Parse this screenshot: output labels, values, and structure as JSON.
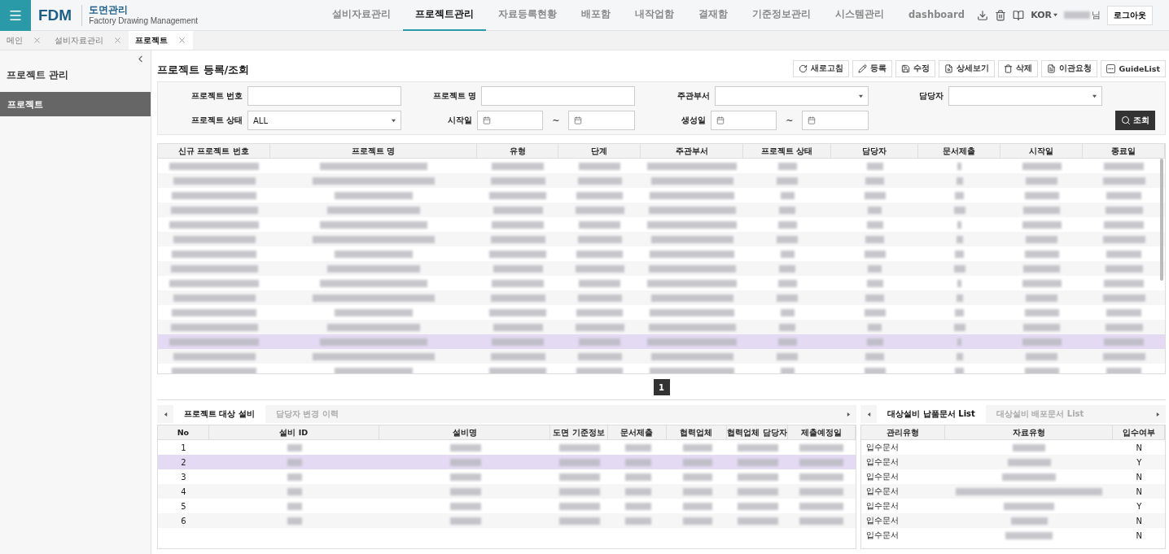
{
  "app": {
    "logo": "FDM",
    "title": "도면관리",
    "subtitle": "Factory Drawing Management"
  },
  "nav": [
    {
      "label": "설비자료관리",
      "selected": false
    },
    {
      "label": "프로젝트관리",
      "selected": true
    },
    {
      "label": "자료등록현황",
      "selected": false
    },
    {
      "label": "배포함",
      "selected": false
    },
    {
      "label": "내작업함",
      "selected": false
    },
    {
      "label": "결재함",
      "selected": false
    },
    {
      "label": "기준정보관리",
      "selected": false
    },
    {
      "label": "시스템관리",
      "selected": false
    },
    {
      "label": "dashboard",
      "selected": false
    }
  ],
  "user": {
    "language": "KOR",
    "suffix": "님",
    "logout": "로그아웃"
  },
  "open_tabs": [
    {
      "label": "메인",
      "selected": false
    },
    {
      "label": "설비자료관리",
      "selected": false
    },
    {
      "label": "프로젝트",
      "selected": true
    }
  ],
  "sidebar": {
    "title": "프로젝트 관리",
    "items": [
      {
        "label": "프로젝트",
        "selected": true
      }
    ]
  },
  "page_title": "프로젝트 등록/조회",
  "toolbar": [
    {
      "label": "새로고침"
    },
    {
      "label": "등록"
    },
    {
      "label": "수정"
    },
    {
      "label": "상세보기"
    },
    {
      "label": "삭제"
    },
    {
      "label": "이관요청"
    },
    {
      "label": "GuideList"
    }
  ],
  "filters": [
    {
      "label": "프로젝트 번호",
      "kind": "text"
    },
    {
      "label": "프로젝트 명",
      "kind": "text"
    },
    {
      "label": "주관부서",
      "kind": "select"
    },
    {
      "label": "담당자",
      "kind": "select"
    },
    {
      "label": "프로젝트 상태",
      "kind": "select",
      "value": "ALL"
    },
    {
      "label": "시작일",
      "kind": "daterange",
      "separator": "~"
    },
    {
      "label": "생성일",
      "kind": "daterange",
      "separator": "~"
    }
  ],
  "search_button": "조회",
  "table": {
    "columns": [
      "신규 프로젝트 번호",
      "프로젝트 명",
      "유형",
      "단계",
      "주관부서",
      "프로젝트 상태",
      "담당자",
      "문서제출",
      "시작일",
      "종료일"
    ],
    "rows": [
      {
        "selected": false
      },
      {
        "selected": false
      },
      {
        "selected": false
      },
      {
        "selected": false
      },
      {
        "selected": false
      },
      {
        "selected": false
      },
      {
        "selected": false
      },
      {
        "selected": false
      },
      {
        "selected": false
      },
      {
        "selected": false
      },
      {
        "selected": false
      },
      {
        "selected": false
      },
      {
        "selected": true
      },
      {
        "selected": false
      },
      {
        "selected": false
      }
    ]
  },
  "pagination": [
    {
      "label": "1",
      "selected": true
    }
  ],
  "equipment_panel": {
    "tabs": [
      {
        "label": "프로젝트 대상 설비",
        "selected": true
      },
      {
        "label": "담당자 변경 이력",
        "selected": false
      }
    ],
    "columns": [
      "No",
      "설비 ID",
      "설비명",
      "도면 기준정보",
      "문서제출",
      "협력업체",
      "협력업체 담당자",
      "제출예정일"
    ],
    "rows": [
      {
        "no": "1",
        "selected": false
      },
      {
        "no": "2",
        "selected": true
      },
      {
        "no": "3",
        "selected": false
      },
      {
        "no": "4",
        "selected": false
      },
      {
        "no": "5",
        "selected": false
      },
      {
        "no": "6",
        "selected": false
      }
    ]
  },
  "document_panel": {
    "tabs": [
      {
        "label": "대상설비 납품문서 List",
        "selected": true
      },
      {
        "label": "대상설비 배포문서 List",
        "selected": false
      }
    ],
    "columns": [
      "관리유형",
      "자료유형",
      "입수여부"
    ],
    "rows": [
      {
        "type": "입수문서",
        "received": "N"
      },
      {
        "type": "입수문서",
        "received": "Y"
      },
      {
        "type": "입수문서",
        "received": "N"
      },
      {
        "type": "입수문서",
        "received": "N"
      },
      {
        "type": "입수문서",
        "received": "Y"
      },
      {
        "type": "입수문서",
        "received": "N"
      },
      {
        "type": "입수문서",
        "received": "N"
      }
    ]
  }
}
